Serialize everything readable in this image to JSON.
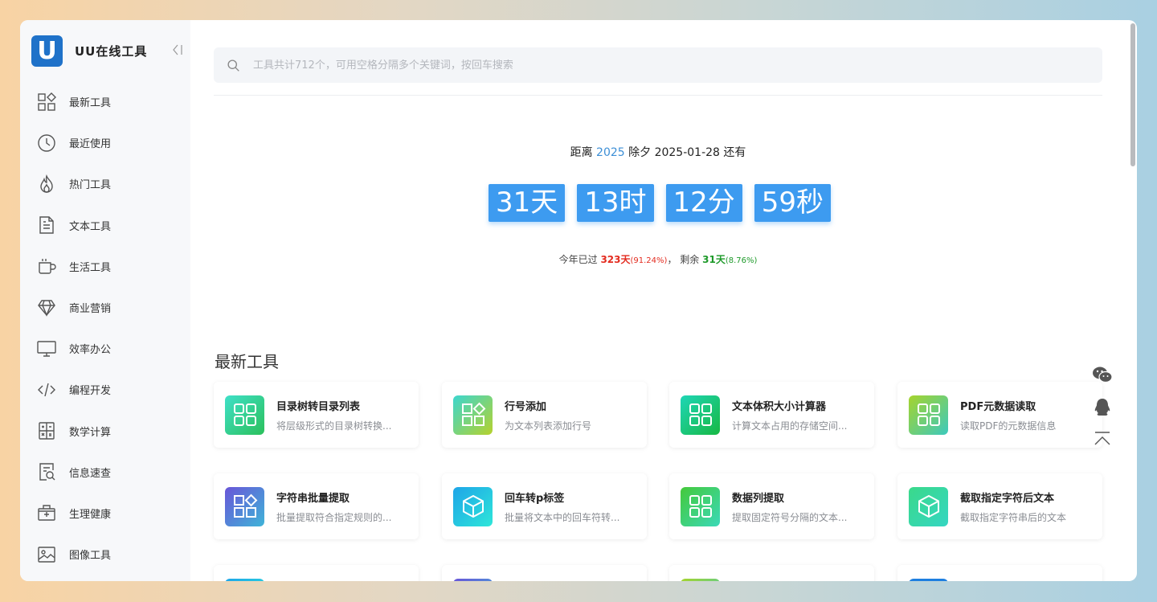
{
  "brand": {
    "logo_letter": "U",
    "name": "UU在线工具"
  },
  "sidebar": {
    "items": [
      {
        "label": "最新工具",
        "icon": "grid-icon"
      },
      {
        "label": "最近使用",
        "icon": "clock-icon"
      },
      {
        "label": "热门工具",
        "icon": "flame-icon"
      },
      {
        "label": "文本工具",
        "icon": "document-icon"
      },
      {
        "label": "生活工具",
        "icon": "cup-icon"
      },
      {
        "label": "商业营销",
        "icon": "diamond-icon"
      },
      {
        "label": "效率办公",
        "icon": "monitor-icon"
      },
      {
        "label": "编程开发",
        "icon": "code-icon"
      },
      {
        "label": "数学计算",
        "icon": "calculator-icon"
      },
      {
        "label": "信息速查",
        "icon": "search-doc-icon"
      },
      {
        "label": "生理健康",
        "icon": "medkit-icon"
      },
      {
        "label": "图像工具",
        "icon": "image-icon"
      }
    ]
  },
  "search": {
    "placeholder": "工具共计712个，可用空格分隔多个关键词，按回车搜索",
    "value": ""
  },
  "countdown": {
    "prefix": "距离",
    "year": "2025",
    "event": "除夕",
    "date": "2025-01-28",
    "suffix": "还有",
    "days": "31天",
    "hours": "13时",
    "minutes": "12分",
    "seconds": "59秒"
  },
  "year_progress": {
    "passed_label": "今年已过",
    "passed_days": "323天",
    "passed_pct": "(91.24%)",
    "sep": "，",
    "remain_label": "剩余",
    "remain_days": "31天",
    "remain_pct": "(8.76%)"
  },
  "section": {
    "title": "最新工具"
  },
  "tools": [
    {
      "name": "目录树转目录列表",
      "desc": "将层级形式的目录树转换...",
      "icon": "grid-squares-icon",
      "color": "teal"
    },
    {
      "name": "行号添加",
      "desc": "为文本列表添加行号",
      "icon": "grid-diamond-icon",
      "color": "lime"
    },
    {
      "name": "文本体积大小计算器",
      "desc": "计算文本占用的存储空间...",
      "icon": "grid-squares-icon",
      "color": "green"
    },
    {
      "name": "PDF元数据读取",
      "desc": "读取PDF的元数据信息",
      "icon": "grid-squares-icon",
      "color": "yg"
    },
    {
      "name": "字符串批量提取",
      "desc": "批量提取符合指定规则的...",
      "icon": "grid-diamond-icon",
      "color": "purple"
    },
    {
      "name": "回车转p标签",
      "desc": "批量将文本中的回车符转...",
      "icon": "cube-icon",
      "color": "cyan"
    },
    {
      "name": "数据列提取",
      "desc": "提取固定符号分隔的文本...",
      "icon": "grid-squares-icon",
      "color": "green2"
    },
    {
      "name": "截取指定字符后文本",
      "desc": "截取指定字符串后的文本",
      "icon": "cube-icon",
      "color": "mint"
    }
  ],
  "float_actions": [
    "wechat-icon",
    "qq-icon",
    "back-to-top-icon"
  ]
}
